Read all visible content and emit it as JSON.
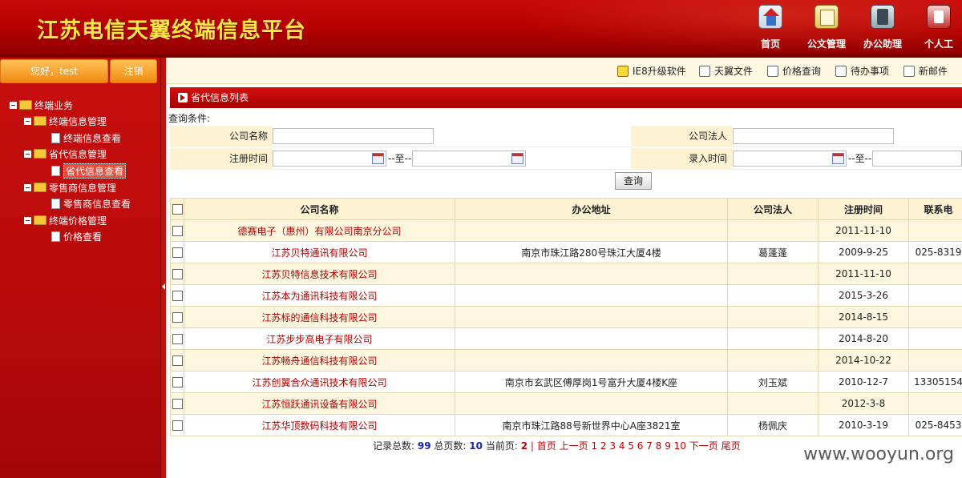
{
  "header": {
    "title": "江苏电信天翼终端信息平台",
    "nav": [
      {
        "label": "首页",
        "icon": "home-icon"
      },
      {
        "label": "公文管理",
        "icon": "document-icon"
      },
      {
        "label": "办公助理",
        "icon": "office-icon"
      },
      {
        "label": "个人工",
        "icon": "person-icon"
      }
    ]
  },
  "sidebar": {
    "greeting": "您好，test",
    "logout": "注销",
    "tree": [
      {
        "label": "终端业务"
      },
      {
        "label": "终端信息管理"
      },
      {
        "label": "终端信息查看"
      },
      {
        "label": "省代信息管理"
      },
      {
        "label": "省代信息查看"
      },
      {
        "label": "零售商信息管理"
      },
      {
        "label": "零售商信息查看"
      },
      {
        "label": "终端价格管理"
      },
      {
        "label": "价格查看"
      }
    ]
  },
  "toolbar": [
    {
      "label": "IE8升级软件",
      "icon": "ie8-upgrade-icon"
    },
    {
      "label": "天翼文件",
      "icon": "file-icon"
    },
    {
      "label": "价格查询",
      "icon": "price-icon"
    },
    {
      "label": "待办事项",
      "icon": "todo-icon"
    },
    {
      "label": "新邮件",
      "icon": "mail-icon"
    }
  ],
  "panel": {
    "title": "省代信息列表",
    "query_label": "查询条件:"
  },
  "query": {
    "company_name_label": "公司名称",
    "legal_person_label": "公司法人",
    "reg_time_label": "注册时间",
    "entry_time_label": "录入时间",
    "to": "--至--",
    "search_button": "查询"
  },
  "table": {
    "headers": [
      "公司名称",
      "办公地址",
      "公司法人",
      "注册时间",
      "联系电"
    ],
    "rows": [
      {
        "name": "德赛电子（惠州）有限公司南京分公司",
        "addr": "",
        "legal": "",
        "date": "2011-11-10",
        "phone": ""
      },
      {
        "name": "江苏贝特通讯有限公司",
        "addr": "南京市珠江路280号珠江大厦4楼",
        "legal": "葛蓬蓬",
        "date": "2009-9-25",
        "phone": "025-8319"
      },
      {
        "name": "江苏贝特信息技术有限公司",
        "addr": "",
        "legal": "",
        "date": "2011-11-10",
        "phone": ""
      },
      {
        "name": "江苏本为通讯科技有限公司",
        "addr": "",
        "legal": "",
        "date": "2015-3-26",
        "phone": ""
      },
      {
        "name": "江苏标的通信科技有限公司",
        "addr": "",
        "legal": "",
        "date": "2014-8-15",
        "phone": ""
      },
      {
        "name": "江苏步步高电子有限公司",
        "addr": "",
        "legal": "",
        "date": "2014-8-20",
        "phone": ""
      },
      {
        "name": "江苏畅舟通信科技有限公司",
        "addr": "",
        "legal": "",
        "date": "2014-10-22",
        "phone": ""
      },
      {
        "name": "江苏创翼合众通讯技术有限公司",
        "addr": "南京市玄武区傅厚岗1号富升大厦4楼K座",
        "legal": "刘玉斌",
        "date": "2010-12-7",
        "phone": "13305154"
      },
      {
        "name": "江苏恒跃通讯设备有限公司",
        "addr": "",
        "legal": "",
        "date": "2012-3-8",
        "phone": ""
      },
      {
        "name": "江苏华顶数码科技有限公司",
        "addr": "南京市珠江路88号新世界中心A座3821室",
        "legal": "杨佩庆",
        "date": "2010-3-19",
        "phone": "025-8453"
      }
    ]
  },
  "pager": {
    "total_label": "记录总数:",
    "total": "99",
    "pages_label": "总页数:",
    "pages": "10",
    "current_label": "当前页:",
    "current": "2",
    "sep": "|",
    "first": "首页",
    "prev": "上一页",
    "page_links": [
      "1",
      "2",
      "3",
      "4",
      "5",
      "6",
      "7",
      "8",
      "9",
      "10"
    ],
    "next": "下一页",
    "last": "尾页"
  },
  "watermark": "www.wooyun.org"
}
